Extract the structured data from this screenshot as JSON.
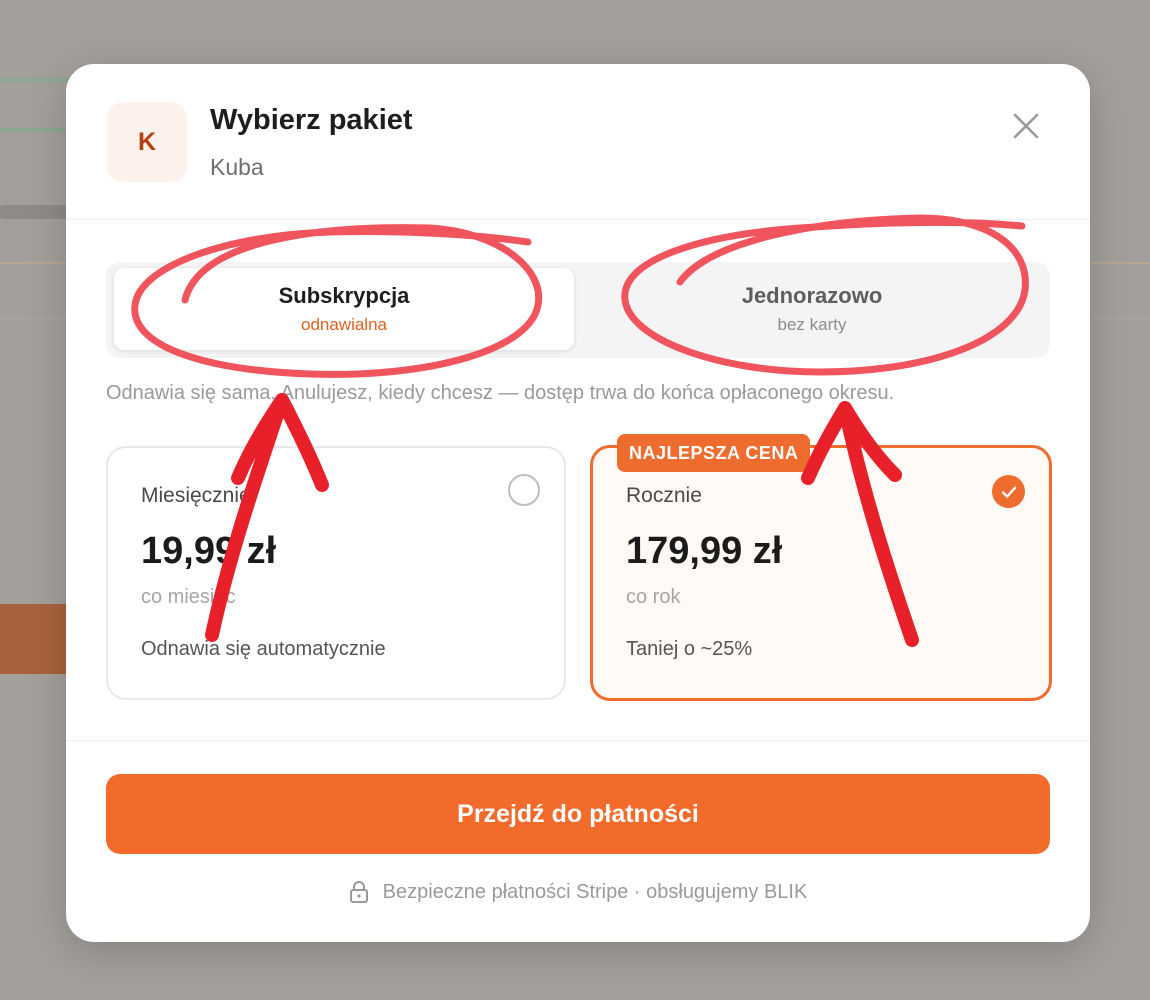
{
  "header": {
    "avatar_letter": "K",
    "title": "Wybierz pakiet",
    "subtitle": "Kuba"
  },
  "icons": {
    "close": "close-icon",
    "check": "check-icon",
    "lock": "lock-icon"
  },
  "tabs": [
    {
      "label": "Subskrypcja",
      "sublabel": "odnawialna",
      "active": true
    },
    {
      "label": "Jednorazowo",
      "sublabel": "bez karty",
      "active": false
    }
  ],
  "description": "Odnawia się sama. Anulujesz, kiedy chcesz — dostęp trwa do końca opłaconego okresu.",
  "plans": [
    {
      "name": "Miesięcznie",
      "price": "19,99 zł",
      "period": "co miesiąc",
      "note": "Odnawia się automatycznie",
      "selected": false
    },
    {
      "name": "Rocznie",
      "price": "179,99 zł",
      "period": "co rok",
      "note": "Taniej o ~25%",
      "badge": "NAJLEPSZA CENA",
      "selected": true
    }
  ],
  "pay_button": "Przejdź do płatności",
  "secure_note": "Bezpieczne płatności Stripe · obsługujemy BLIK",
  "colors": {
    "accent": "#f26b2b",
    "annotation": "#e8202a"
  }
}
